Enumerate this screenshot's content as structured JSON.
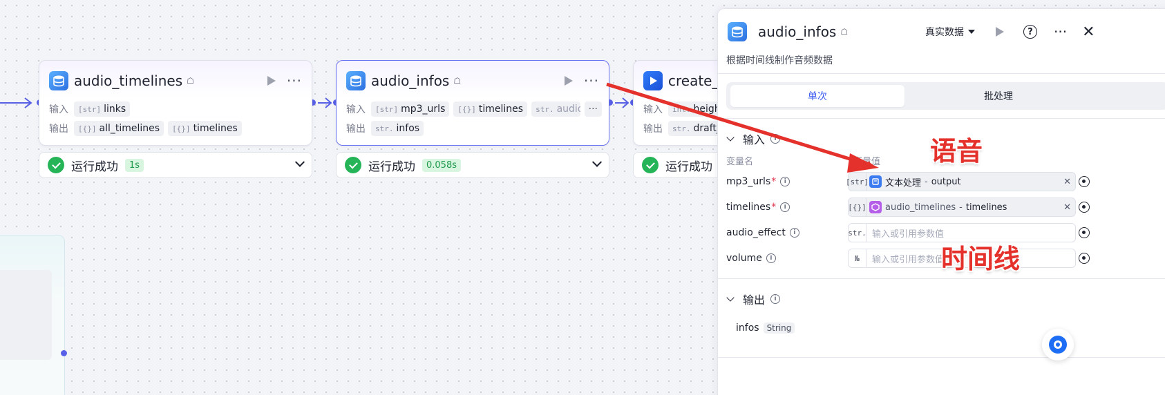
{
  "nodes": {
    "n1": {
      "title": "audio_timelines",
      "input_label": "输入",
      "output_label": "输出",
      "inputs": [
        {
          "type": "[str]",
          "name": "links"
        }
      ],
      "outputs": [
        {
          "type": "[{}]",
          "name": "all_timelines"
        },
        {
          "type": "[{}]",
          "name": "timelines"
        }
      ],
      "status": "运行成功",
      "time": "1s"
    },
    "n2": {
      "title": "audio_infos",
      "input_label": "输入",
      "output_label": "输出",
      "inputs": [
        {
          "type": "[str]",
          "name": "mp3_urls"
        },
        {
          "type": "[{}]",
          "name": "timelines"
        },
        {
          "type": "str.",
          "name": "audio_effect"
        }
      ],
      "more": "···",
      "outputs": [
        {
          "type": "str.",
          "name": "infos"
        }
      ],
      "status": "运行成功",
      "time": "0.058s"
    },
    "n3": {
      "title": "create_d",
      "input_label": "输入",
      "output_label": "输出",
      "inputs": [
        {
          "type": "int.",
          "name": "height"
        }
      ],
      "outputs": [
        {
          "type": "str.",
          "name": "draft_ur"
        }
      ],
      "status": "运行成功"
    }
  },
  "panel": {
    "title": "audio_infos",
    "data_mode": "真实数据",
    "help": "?",
    "close": "✕",
    "description": "根据时间线制作音频数据",
    "tabs": [
      "单次",
      "批处理"
    ],
    "input_section": "输入",
    "col_name": "变量名",
    "col_value": "变量值",
    "params": [
      {
        "name": "mp3_urls",
        "required": true,
        "type": "[str]",
        "ref_src": "文本处理",
        "ref_sep": "-",
        "ref_field": "output"
      },
      {
        "name": "timelines",
        "required": true,
        "type": "[{}]",
        "ref_src": "audio_timelines",
        "ref_sep": "-",
        "ref_field": "timelines"
      },
      {
        "name": "audio_effect",
        "required": false,
        "type": "str.",
        "placeholder": "输入或引用参数值"
      },
      {
        "name": "volume",
        "required": false,
        "type": "№",
        "placeholder": "输入或引用参数值"
      }
    ],
    "output_section": "输出",
    "outputs": [
      {
        "name": "infos",
        "type": "String"
      }
    ]
  },
  "annotations": {
    "voice": "语音",
    "timeline": "时间线",
    "color": "#e5312b"
  },
  "colors": {
    "edge": "#5860e6",
    "success": "#26b458",
    "accent": "#3c5bf0"
  }
}
